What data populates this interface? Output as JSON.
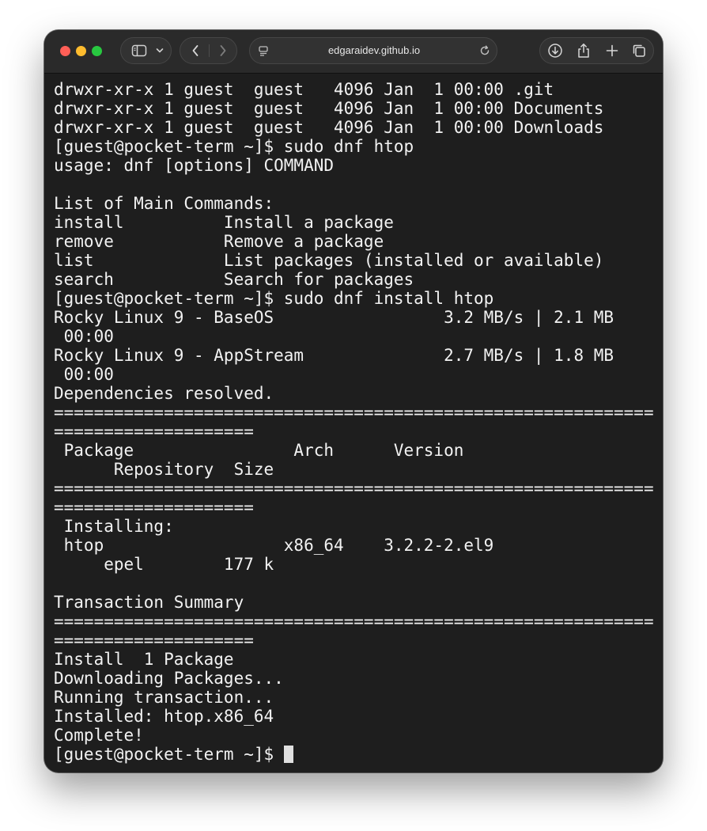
{
  "browser": {
    "url": "edgaraidev.github.io",
    "icons": {
      "sidebar": "sidebar-icon",
      "dropdown": "chevron-down-icon",
      "back": "chevron-left-icon",
      "forward": "chevron-right-icon",
      "site_settings": "page-settings-icon",
      "reload": "reload-icon",
      "downloads": "download-icon",
      "share": "share-icon",
      "new_tab": "plus-icon",
      "tab_overview": "tabs-icon"
    }
  },
  "terminal": {
    "lines": [
      "drwxr-xr-x 1 guest  guest   4096 Jan  1 00:00 .git",
      "drwxr-xr-x 1 guest  guest   4096 Jan  1 00:00 Documents",
      "drwxr-xr-x 1 guest  guest   4096 Jan  1 00:00 Downloads",
      "[guest@pocket-term ~]$ sudo dnf htop",
      "usage: dnf [options] COMMAND",
      "",
      "List of Main Commands:",
      "install          Install a package",
      "remove           Remove a package",
      "list             List packages (installed or available)",
      "search           Search for packages",
      "[guest@pocket-term ~]$ sudo dnf install htop",
      "Rocky Linux 9 - BaseOS                 3.2 MB/s | 2.1 MB",
      " 00:00",
      "Rocky Linux 9 - AppStream              2.7 MB/s | 1.8 MB",
      " 00:00",
      "Dependencies resolved.",
      "============================================================",
      "====================",
      " Package                Arch      Version",
      "      Repository  Size",
      "============================================================",
      "====================",
      " Installing:",
      " htop                  x86_64    3.2.2-2.el9",
      "     epel        177 k",
      "",
      "Transaction Summary",
      "============================================================",
      "====================",
      "Install  1 Package",
      "Downloading Packages...",
      "Running transaction...",
      "Installed: htop.x86_64",
      "Complete!"
    ],
    "prompt": "[guest@pocket-term ~]$ "
  },
  "colors": {
    "terminal_background": "#1e1e1e",
    "terminal_text": "#f2f2f2",
    "titlebar": "#2a2a2a",
    "close": "#ff5f57",
    "minimize": "#febc2e",
    "zoom": "#28c840"
  }
}
